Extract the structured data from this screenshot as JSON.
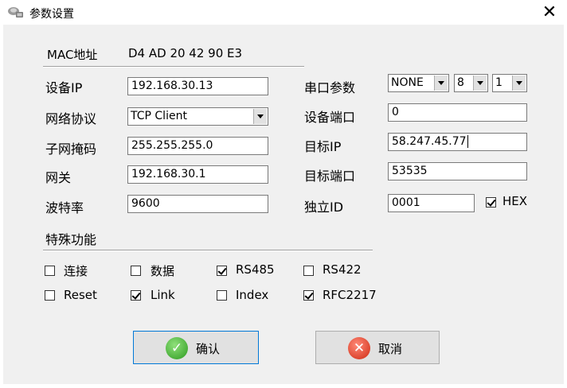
{
  "window": {
    "title": "参数设置",
    "close_glyph": "✕"
  },
  "mac": {
    "label": "MAC地址",
    "value": "D4 AD 20 42 90 E3"
  },
  "left_fields": [
    {
      "label": "设备IP",
      "value": "192.168.30.13"
    },
    {
      "label": "网络协议",
      "value": "TCP Client"
    },
    {
      "label": "子网掩码",
      "value": "255.255.255.0"
    },
    {
      "label": "网关",
      "value": "192.168.30.1"
    },
    {
      "label": "波特率",
      "value": "9600"
    }
  ],
  "serial": {
    "label": "串口参数",
    "parity": "NONE",
    "data_bits": "8",
    "stop_bits": "1"
  },
  "right_fields": [
    {
      "label": "设备端口",
      "value": "0"
    },
    {
      "label": "目标IP",
      "value": "58.247.45.77"
    },
    {
      "label": "目标端口",
      "value": "53535"
    },
    {
      "label": "独立ID",
      "value": "0001"
    }
  ],
  "hex": {
    "label": "HEX",
    "checked": true
  },
  "special": {
    "label": "特殊功能",
    "options": [
      {
        "label": "连接",
        "checked": false
      },
      {
        "label": "数据",
        "checked": false
      },
      {
        "label": "RS485",
        "checked": true
      },
      {
        "label": "RS422",
        "checked": false
      },
      {
        "label": "Reset",
        "checked": false
      },
      {
        "label": "Link",
        "checked": true
      },
      {
        "label": "Index",
        "checked": false
      },
      {
        "label": "RFC2217",
        "checked": true
      }
    ]
  },
  "buttons": {
    "ok": "确认",
    "cancel": "取消"
  },
  "icons": {
    "app": "network-settings-icon",
    "ok": "checkmark-icon",
    "cancel": "cancel-x-icon"
  },
  "colors": {
    "ok_icon": "#3aa52a",
    "cancel_icon": "#e0301a",
    "focus_border": "#0078d7"
  }
}
